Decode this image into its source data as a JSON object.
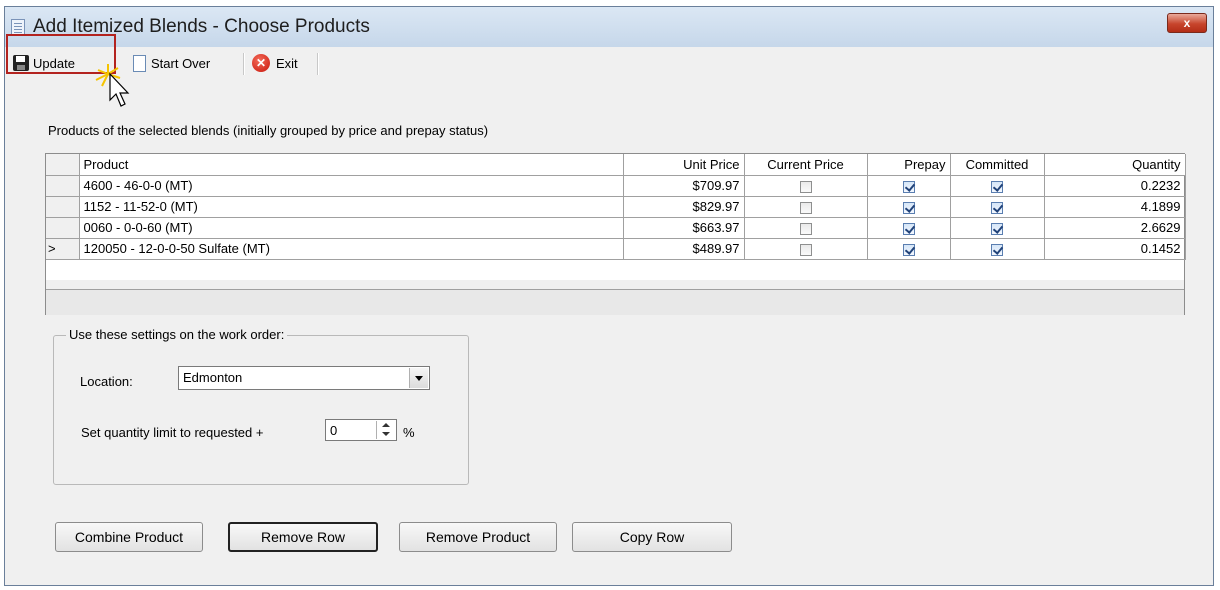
{
  "window": {
    "title": "Add Itemized Blends - Choose Products",
    "close_label": "x"
  },
  "toolbar": {
    "update_label": "Update",
    "start_over_label": "Start Over",
    "exit_label": "Exit"
  },
  "section_label": "Products of the selected blends (initially grouped by price and prepay status)",
  "grid": {
    "columns": [
      "Product",
      "Unit Price",
      "Current Price",
      "Prepay",
      "Committed",
      "Quantity"
    ],
    "rows": [
      {
        "marker": "",
        "product": "4600 - 46-0-0 (MT)",
        "unit_price": "$709.97",
        "current_price": false,
        "prepay": true,
        "committed": true,
        "quantity": "0.2232"
      },
      {
        "marker": "",
        "product": "1152 - 11-52-0 (MT)",
        "unit_price": "$829.97",
        "current_price": false,
        "prepay": true,
        "committed": true,
        "quantity": "4.1899"
      },
      {
        "marker": "",
        "product": "0060 - 0-0-60 (MT)",
        "unit_price": "$663.97",
        "current_price": false,
        "prepay": true,
        "committed": true,
        "quantity": "2.6629"
      },
      {
        "marker": ">",
        "product": "120050 - 12-0-0-50 Sulfate (MT)",
        "unit_price": "$489.97",
        "current_price": false,
        "prepay": true,
        "committed": true,
        "quantity": "0.1452"
      }
    ]
  },
  "settings": {
    "legend": "Use these settings on the work order:",
    "location_label": "Location:",
    "location_value": "Edmonton",
    "qty_label": "Set quantity limit to requested +",
    "qty_value": "0",
    "pct": "%"
  },
  "buttons": {
    "combine": "Combine Product",
    "remove_row": "Remove Row",
    "remove_product": "Remove Product",
    "copy_row": "Copy Row"
  },
  "colors": {
    "highlight": "#b3231f",
    "titlebar": "#c6d7ea",
    "close": "#c7452c"
  }
}
